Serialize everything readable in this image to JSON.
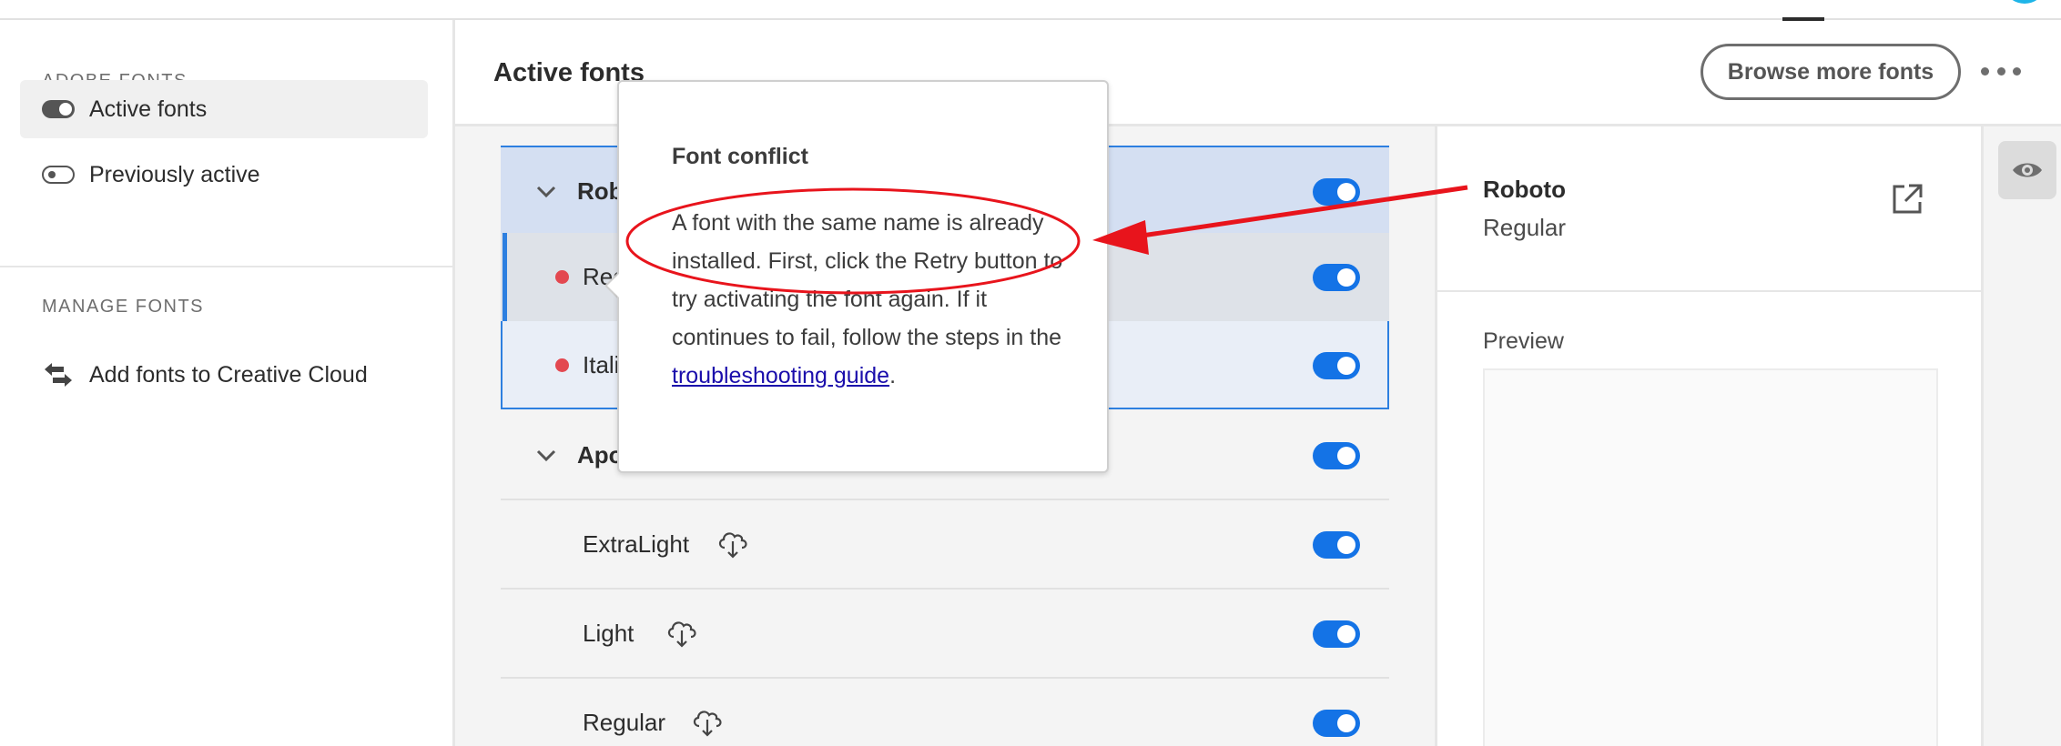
{
  "sidebar": {
    "sections": [
      {
        "heading": "ADOBE FONTS",
        "items": [
          {
            "label": "Active fonts",
            "icon": "toggle-on-icon",
            "selected": true
          },
          {
            "label": "Previously active",
            "icon": "toggle-off-icon",
            "selected": false
          }
        ]
      },
      {
        "heading": "MANAGE FONTS",
        "items": [
          {
            "label": "Add fonts to Creative Cloud",
            "icon": "swap-arrows-icon"
          }
        ]
      }
    ]
  },
  "header": {
    "title": "Active fonts",
    "browse_label": "Browse more fonts",
    "more_icon": "more-horizontal-icon"
  },
  "font_list": {
    "families": [
      {
        "name": "Robo",
        "active": true,
        "styles": [
          {
            "label": "Reg",
            "status": "error",
            "selected": true,
            "active": true
          },
          {
            "label": "Itali",
            "status": "error",
            "selected": false,
            "active": true
          }
        ]
      },
      {
        "name": "Apo",
        "active": true,
        "styles": [
          {
            "label": "ExtraLight",
            "icon": "cloud-download-icon",
            "active": true
          },
          {
            "label": "Light",
            "icon": "cloud-download-icon",
            "active": true
          },
          {
            "label": "Regular",
            "icon": "cloud-download-icon",
            "active": true
          }
        ]
      }
    ]
  },
  "details": {
    "font_name": "Roboto",
    "font_style": "Regular",
    "preview_label": "Preview",
    "open_icon": "external-link-icon"
  },
  "rail": {
    "icon": "eye-icon"
  },
  "popover": {
    "title": "Font conflict",
    "body_text": "A font with the same name is already installed. First, click the Retry button to try activating the font again. If it continues to fail, follow the steps in the ",
    "link_text": "troubleshooting guide",
    "body_end": "."
  },
  "colors": {
    "accent": "#1473e6",
    "selection_border": "#2d7fe0",
    "error": "#e34850",
    "annotation": "#e8141c"
  }
}
